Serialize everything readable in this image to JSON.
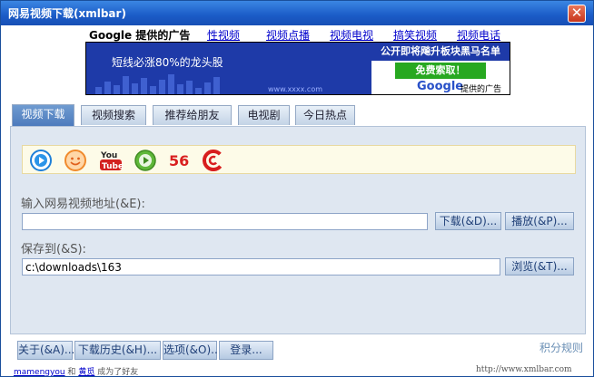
{
  "window": {
    "title": "网易视频下载(xmlbar)",
    "close_label": "✕"
  },
  "ad_links": {
    "google_label": "Google 提供的广告",
    "links": [
      "性视频",
      "视频点播",
      "视频电视",
      "搞笑视频",
      "视频电话"
    ]
  },
  "banner": {
    "left_text": "短线必涨80%的龙头股",
    "left_url": "www.xxxx.com",
    "right_headline": "公开即将飚升板块黑马名单",
    "right_button": "免费索取！",
    "google_word": "Google",
    "google_ad_label": "提供的广告"
  },
  "tabs": [
    "视频下载",
    "视频搜索",
    "推荐给朋友",
    "电视剧",
    "今日热点"
  ],
  "site_icons": [
    "play-circle-icon",
    "smile-face-icon",
    "youtube-icon",
    "green-play-icon",
    "56-logo-icon",
    "red-c-icon"
  ],
  "colors": {
    "accent": "#1b5bc7",
    "panel": "#dfe7f1",
    "link": "#0000cc"
  },
  "form": {
    "url_label": "输入网易视频地址(&E):",
    "url_value": "",
    "download_button": "下载(&D)...",
    "play_button": "播放(&P)...",
    "save_label": "保存到(&S):",
    "save_value": "c:\\downloads\\163",
    "browse_button": "浏览(&T)..."
  },
  "footer": {
    "about_button": "关于(&A)...",
    "history_button": "下载历史(&H)...",
    "options_button": "选项(&O)...",
    "login_button": "登录...",
    "points_link": "积分规则",
    "status_user1": "mamengyou",
    "status_and": "和",
    "status_user2": "黄觅",
    "status_suffix": "成为了好友",
    "status_url": "http://www.xmlbar.com"
  }
}
